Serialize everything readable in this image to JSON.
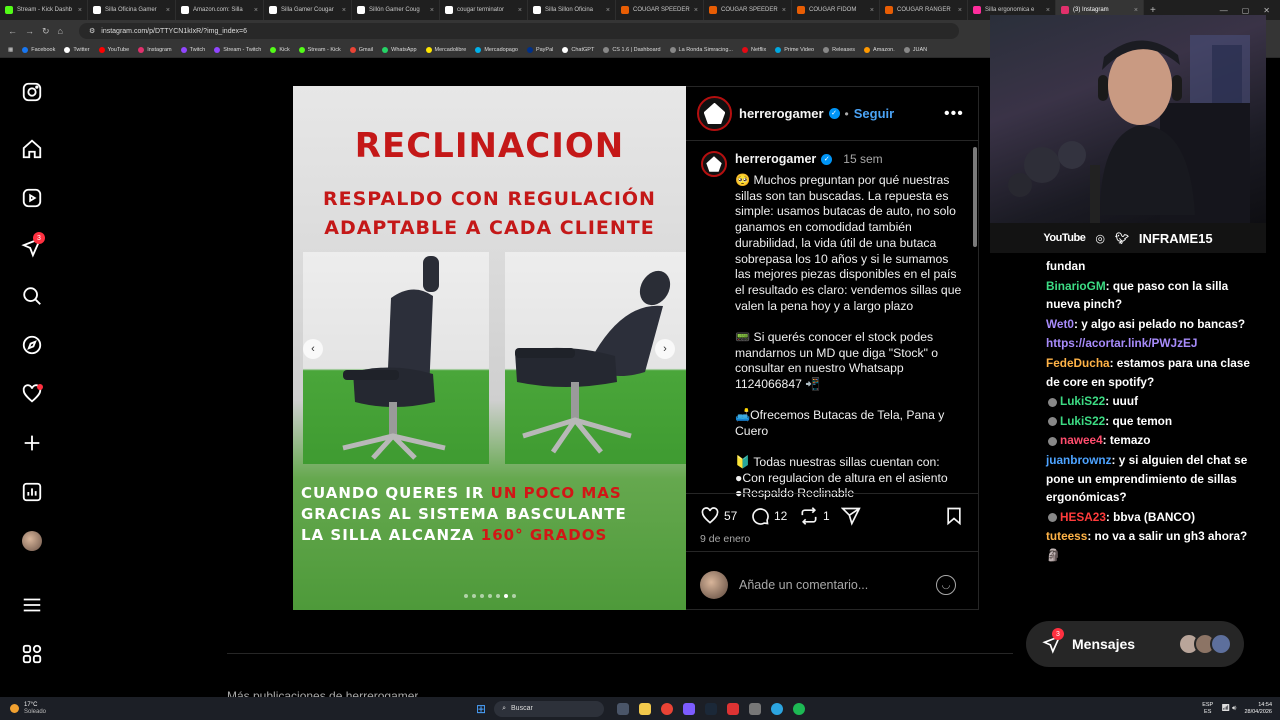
{
  "browser": {
    "tabs": [
      {
        "label": "Stream - Kick Dashb",
        "color": "#53fc18"
      },
      {
        "label": "Silla Oficina Gamer",
        "color": "#ffffff"
      },
      {
        "label": "Amazon.com: Silla",
        "color": "#ffffff"
      },
      {
        "label": "Silla Gamer Cougar",
        "color": "#ffffff"
      },
      {
        "label": "Sillón Gamer Coug",
        "color": "#ffffff"
      },
      {
        "label": "cougar terminator",
        "color": "#ffffff"
      },
      {
        "label": "Silla Sillon Oficina",
        "color": "#ffffff"
      },
      {
        "label": "COUGAR SPEEDER",
        "color": "#e85d04"
      },
      {
        "label": "COUGAR SPEEDER",
        "color": "#e85d04"
      },
      {
        "label": "COUGAR FIDOM",
        "color": "#e85d04"
      },
      {
        "label": "COUGAR RANGER",
        "color": "#e85d04"
      },
      {
        "label": "Silla ergonomica e",
        "color": "#ff2d9c"
      },
      {
        "label": "(3) Instagram",
        "color": "#e1306c",
        "active": true
      }
    ],
    "url": "instagram.com/p/DTTYCN1kIxR/?img_index=6",
    "bookmarks": [
      {
        "label": "Facebook",
        "color": "#1877f2"
      },
      {
        "label": "Twitter",
        "color": "#ffffff"
      },
      {
        "label": "YouTube",
        "color": "#ff0000"
      },
      {
        "label": "Instagram",
        "color": "#e1306c"
      },
      {
        "label": "Twitch",
        "color": "#9146ff"
      },
      {
        "label": "Stream - Twitch",
        "color": "#9146ff"
      },
      {
        "label": "Kick",
        "color": "#53fc18"
      },
      {
        "label": "Stream - Kick",
        "color": "#53fc18"
      },
      {
        "label": "Gmail",
        "color": "#ea4335"
      },
      {
        "label": "WhatsApp",
        "color": "#25d366"
      },
      {
        "label": "Mercadolibre",
        "color": "#ffe600"
      },
      {
        "label": "Mercadopago",
        "color": "#00b1ea"
      },
      {
        "label": "PayPal",
        "color": "#003087"
      },
      {
        "label": "ChatGPT",
        "color": "#ffffff"
      },
      {
        "label": "CS 1.6 | Dashboard",
        "color": "#888888"
      },
      {
        "label": "La Ronda Simracing...",
        "color": "#888888"
      },
      {
        "label": "Netflix",
        "color": "#e50914"
      },
      {
        "label": "Prime Video",
        "color": "#00a8e1"
      },
      {
        "label": "Releases",
        "color": "#888888"
      },
      {
        "label": "Amazon.",
        "color": "#ff9900"
      },
      {
        "label": "JUAN",
        "color": "#888888"
      }
    ]
  },
  "instagram": {
    "notification_badge": "3",
    "post": {
      "username": "herrerogamer",
      "follow_label": "Seguir",
      "time_ago": "15 sem",
      "image_text": {
        "title": "RECLINACION",
        "subtitle1": "RESPALDO CON REGULACIÓN",
        "subtitle2": "ADAPTABLE A CADA CLIENTE",
        "bottom1a": "CUANDO QUERES IR ",
        "bottom1b": "UN POCO MAS",
        "bottom2": "GRACIAS AL SISTEMA BASCULANTE",
        "bottom3a": "LA SILLA ALCANZA ",
        "bottom3b": "160° GRADOS"
      },
      "caption_paragraphs": [
        "🥺 Muchos preguntan por qué nuestras sillas son tan buscadas. La repuesta es simple: usamos butacas de auto, no solo ganamos en comodidad también durabilidad, la vida útil de una butaca sobrepasa los 10 años y si le sumamos las mejores piezas disponibles en el país el resultado es claro: vendemos sillas que valen la pena hoy y a largo plazo",
        "📟 Si querés conocer el stock podes mandarnos un MD que diga \"Stock\" o consultar en nuestro Whatsapp 1124066847 📲",
        "🛋️Ofrecemos Butacas de Tela, Pana y Cuero",
        "🔰 Todas nuestras sillas cuentan con:",
        "●Con regulacion de altura en el asiento",
        "●Respaldo Reclinable"
      ],
      "likes": "57",
      "comments": "12",
      "reposts": "1",
      "date": "9 de enero",
      "comment_placeholder": "Añade un comentario...",
      "carousel_active_index": 5,
      "carousel_count": 7
    },
    "more_posts_label": "Más publicaciones de herrerogamer",
    "messages_label": "Mensajes",
    "messages_badge": "3"
  },
  "stream_overlay": {
    "youtube_label": "YouTube",
    "channel_name": "INFRAME15"
  },
  "chat": [
    {
      "user": "",
      "text": "fundan",
      "color": "#ffffff"
    },
    {
      "user": "BinarioGM",
      "text": ": que paso con la silla nueva pinch?",
      "color": "#3ddc84"
    },
    {
      "user": "Wet0",
      "text": ": y algo asi pelado no bancas?",
      "color": "#a78bfa"
    },
    {
      "user": "",
      "text": "https://acortar.link/PWJzEJ",
      "color": "#a78bfa",
      "is_link": true
    },
    {
      "user": "FedeDucha",
      "text": ": estamos para una clase de core en spotify?",
      "color": "#ffb347"
    },
    {
      "user": "LukiS22",
      "text": ": uuuf",
      "color": "#3ddc84",
      "icon": true
    },
    {
      "user": "LukiS22",
      "text": ": que temon",
      "color": "#3ddc84",
      "icon": true
    },
    {
      "user": "nawee4",
      "text": ": temazo",
      "color": "#ff4d6d",
      "icon": true
    },
    {
      "user": "juanbrownz",
      "text": ": y si alguien del chat se pone un emprendimiento de sillas ergonómicas?",
      "color": "#4da3ff"
    },
    {
      "user": "HESA23",
      "text": ": bbva (BANCO)",
      "color": "#ff3b3b",
      "icon": true
    },
    {
      "user": "tuteess",
      "text": ": no va a salir un gh3 ahora? 🗿",
      "color": "#ffb347"
    }
  ],
  "taskbar": {
    "weather_temp": "17°C",
    "weather_desc": "Soleado",
    "search_placeholder": "Buscar",
    "lang_top": "ESP",
    "lang_bottom": "ES",
    "time": "14:54",
    "date": "28/04/2026"
  }
}
